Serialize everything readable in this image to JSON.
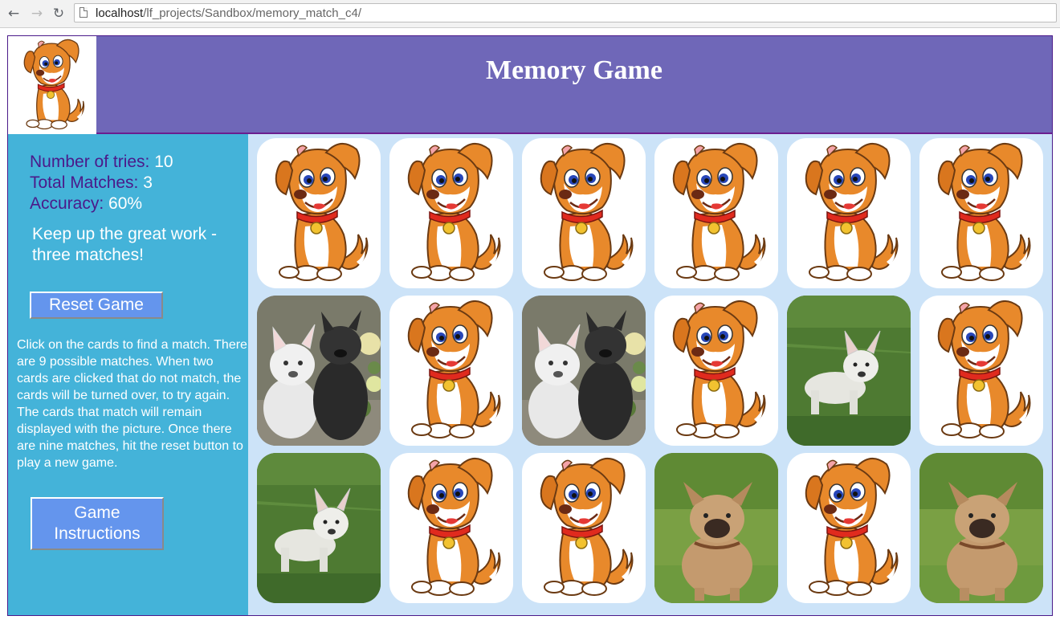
{
  "browser": {
    "url_host": "localhost",
    "url_path": "/lf_projects/Sandbox/memory_match_c4/"
  },
  "header": {
    "title": "Memory Game",
    "logo_icon": "cartoon-puppy-icon",
    "bg_color": "#6f67b8"
  },
  "stats": {
    "tries_label": "Number of tries:",
    "tries_value": "10",
    "matches_label": "Total Matches:",
    "matches_value": "3",
    "accuracy_label": "Accuracy:",
    "accuracy_value": "60%"
  },
  "message": "Keep up the great work - three matches!",
  "buttons": {
    "reset_label": "Reset Game",
    "instructions_label": "Game Instructions"
  },
  "instructions_text": "Click on the cards to find a match. There are 9 possible matches. When two cards are clicked that do not match, the cards will be turned over, to try again. The cards that match will remain displayed with the picture. Once there are nine matches, hit the reset button to play a new game.",
  "colors": {
    "sidebar": "#44b3d9",
    "board": "#cce3f8",
    "button": "#6495ed",
    "label": "#4b1a8a"
  },
  "cards": [
    {
      "state": "face-down",
      "image": "cartoon-puppy-icon"
    },
    {
      "state": "face-down",
      "image": "cartoon-puppy-icon"
    },
    {
      "state": "face-down",
      "image": "cartoon-puppy-icon"
    },
    {
      "state": "face-down",
      "image": "cartoon-puppy-icon"
    },
    {
      "state": "face-down",
      "image": "cartoon-puppy-icon"
    },
    {
      "state": "face-down",
      "image": "cartoon-puppy-icon"
    },
    {
      "state": "face-up",
      "image": "white-and-black-bulldogs-photo"
    },
    {
      "state": "face-down",
      "image": "cartoon-puppy-icon"
    },
    {
      "state": "face-up",
      "image": "white-and-black-bulldogs-photo"
    },
    {
      "state": "face-down",
      "image": "cartoon-puppy-icon"
    },
    {
      "state": "face-up",
      "image": "white-bulldog-on-grass-photo"
    },
    {
      "state": "face-down",
      "image": "cartoon-puppy-icon"
    },
    {
      "state": "face-up",
      "image": "white-bulldog-on-grass-photo"
    },
    {
      "state": "face-down",
      "image": "cartoon-puppy-icon"
    },
    {
      "state": "face-down",
      "image": "cartoon-puppy-icon"
    },
    {
      "state": "face-up",
      "image": "fawn-bulldog-on-grass-photo"
    },
    {
      "state": "face-down",
      "image": "cartoon-puppy-icon"
    },
    {
      "state": "face-up",
      "image": "fawn-bulldog-on-grass-photo"
    }
  ]
}
